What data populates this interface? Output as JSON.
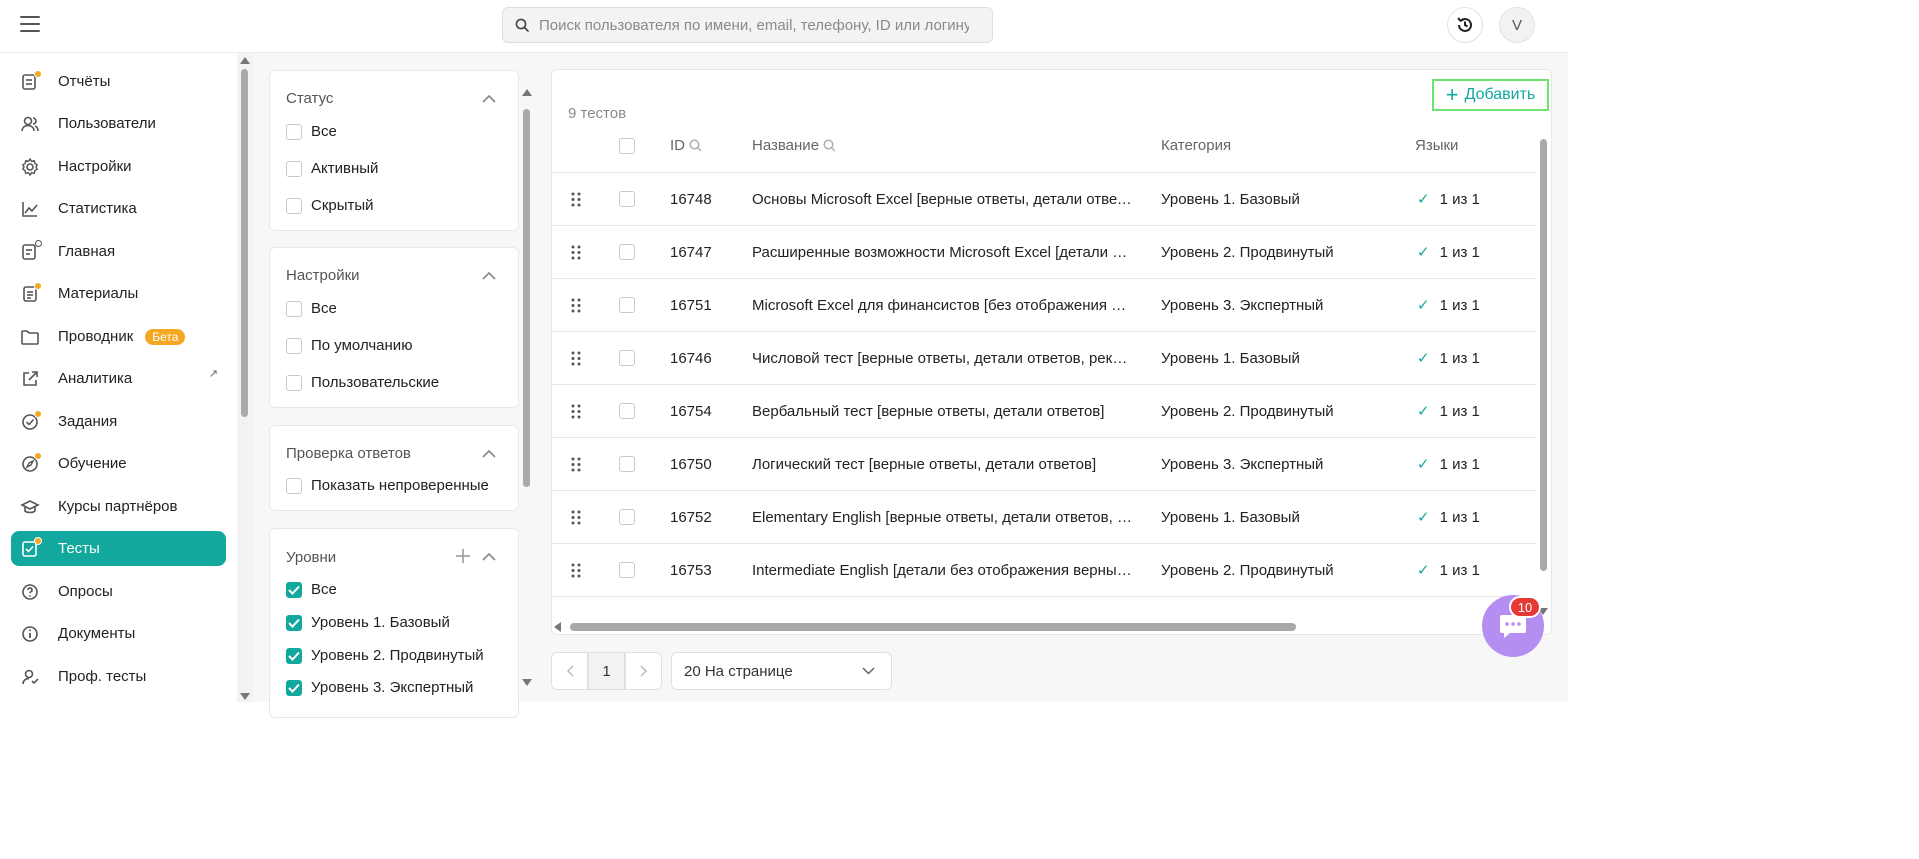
{
  "topbar": {
    "search_placeholder": "Поиск пользователя по имени, email, телефону, ID или логину",
    "avatar_initial": "V"
  },
  "sidebar": {
    "items": [
      {
        "label": "Отчёты",
        "icon": "report-icon"
      },
      {
        "label": "Пользователи",
        "icon": "users-icon"
      },
      {
        "label": "Настройки",
        "icon": "gear-icon"
      },
      {
        "label": "Статистика",
        "icon": "chart-line-icon"
      },
      {
        "label": "Главная",
        "icon": "home-doc-icon"
      },
      {
        "label": "Материалы",
        "icon": "materials-icon"
      },
      {
        "label": "Проводник",
        "icon": "folder-icon",
        "badge": "Бета"
      },
      {
        "label": "Аналитика",
        "icon": "external-link-icon"
      },
      {
        "label": "Задания",
        "icon": "task-icon"
      },
      {
        "label": "Обучение",
        "icon": "education-icon"
      },
      {
        "label": "Курсы партнёров",
        "icon": "graduation-cap-icon"
      },
      {
        "label": "Тесты",
        "icon": "tests-icon",
        "active": true
      },
      {
        "label": "Опросы",
        "icon": "question-icon"
      },
      {
        "label": "Документы",
        "icon": "info-icon"
      },
      {
        "label": "Проф. тесты",
        "icon": "user-check-icon"
      }
    ]
  },
  "filters": {
    "status": {
      "title": "Статус",
      "options": [
        "Все",
        "Активный",
        "Скрытый"
      ]
    },
    "settings": {
      "title": "Настройки",
      "options": [
        "Все",
        "По умолчанию",
        "Пользовательские"
      ]
    },
    "review": {
      "title": "Проверка ответов",
      "options": [
        "Показать непроверенные"
      ]
    },
    "levels": {
      "title": "Уровни",
      "options": [
        "Все",
        "Уровень 1. Базовый",
        "Уровень 2. Продвинутый",
        "Уровень 3. Экспертный"
      ]
    }
  },
  "table": {
    "count_label": "9 тестов",
    "add_label": "Добавить",
    "columns": {
      "id": "ID",
      "name": "Название",
      "category": "Категория",
      "languages": "Языки"
    },
    "rows": [
      {
        "id": "16748",
        "name": "Основы Microsoft Excel [верные ответы, детали ответов]",
        "category": "Уровень 1. Базовый",
        "languages": "1 из 1"
      },
      {
        "id": "16747",
        "name": "Расширенные возможности Microsoft Excel [детали без отображения верных]",
        "category": "Уровень 2. Продвинутый",
        "languages": "1 из 1"
      },
      {
        "id": "16751",
        "name": "Microsoft Excel для финансистов [без отображения верных ответов]",
        "category": "Уровень 3. Экспертный",
        "languages": "1 из 1"
      },
      {
        "id": "16746",
        "name": "Числовой тест [верные ответы, детали ответов, рекомендации]",
        "category": "Уровень 1. Базовый",
        "languages": "1 из 1"
      },
      {
        "id": "16754",
        "name": "Вербальный тест [верные ответы, детали ответов]",
        "category": "Уровень 2. Продвинутый",
        "languages": "1 из 1"
      },
      {
        "id": "16750",
        "name": "Логический тест [верные ответы, детали ответов]",
        "category": "Уровень 3. Экспертный",
        "languages": "1 из 1"
      },
      {
        "id": "16752",
        "name": "Elementary English [верные ответы, детали ответов, рекомендации]",
        "category": "Уровень 1. Базовый",
        "languages": "1 из 1"
      },
      {
        "id": "16753",
        "name": "Intermediate English [детали без отображения верных ответов]",
        "category": "Уровень 2. Продвинутый",
        "languages": "1 из 1"
      }
    ]
  },
  "pagination": {
    "current_page": "1",
    "per_page_label": "20 На странице"
  },
  "chat": {
    "unread_count": "10"
  },
  "colors": {
    "accent": "#13a89e",
    "badge_orange": "#f5a623",
    "highlight_green": "#6fe36f",
    "chat_purple": "#b48ef0",
    "notification_red": "#e53935"
  }
}
